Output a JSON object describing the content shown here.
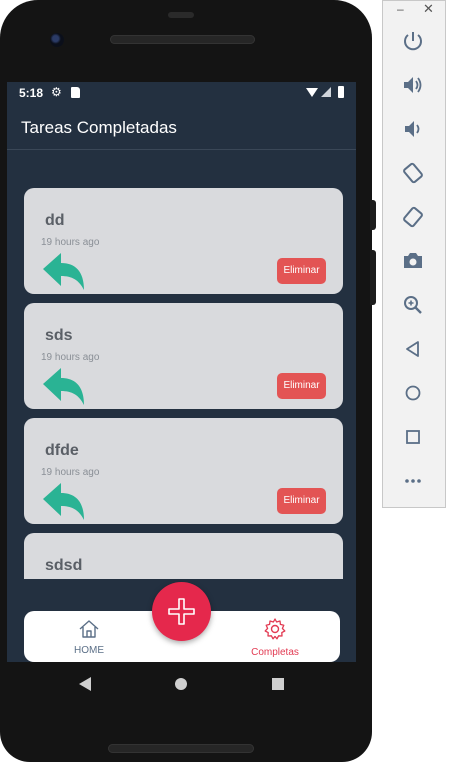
{
  "status_bar": {
    "time": "5:18"
  },
  "app": {
    "title": "Tareas Completadas"
  },
  "tasks": [
    {
      "title": "dd",
      "time": "19 hours ago",
      "delete_label": "Eliminar"
    },
    {
      "title": "sds",
      "time": "19 hours ago",
      "delete_label": "Eliminar"
    },
    {
      "title": "dfde",
      "time": "19 hours ago",
      "delete_label": "Eliminar"
    },
    {
      "title": "sdsd"
    }
  ],
  "bottom_nav": {
    "home_label": "HOME",
    "completed_label": "Completas"
  },
  "icons": {
    "undo": "undo-arrow-icon",
    "fab": "plus-icon",
    "home": "home-icon",
    "completed": "gear-icon"
  },
  "colors": {
    "screen_bg": "#233040",
    "card_bg": "#d9dadd",
    "accent_red": "#e5284c",
    "delete_red": "#e35454",
    "undo_green": "#2ab394"
  }
}
